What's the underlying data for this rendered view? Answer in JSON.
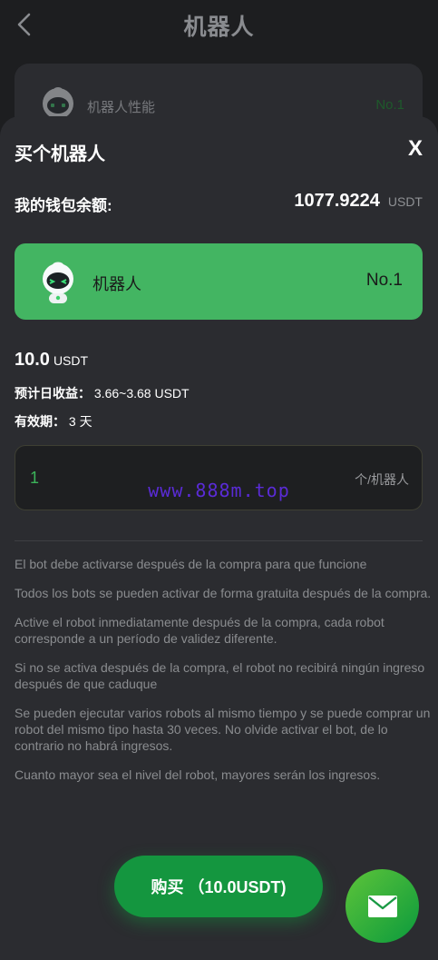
{
  "header": {
    "title": "机器人"
  },
  "background_card": {
    "label": "机器人性能",
    "rank": "No.1"
  },
  "sheet": {
    "title": "买个机器人",
    "close_label": "X",
    "wallet": {
      "label": "我的钱包余额:",
      "amount": "1077.9224",
      "unit": "USDT"
    },
    "robot": {
      "name": "机器人",
      "rank": "No.1"
    },
    "price": {
      "value": "10.0",
      "unit": "USDT"
    },
    "daily_income": {
      "label": "预计日收益：",
      "value": "3.66~3.68 USDT"
    },
    "validity": {
      "label": "有效期：",
      "value": "3 天"
    },
    "quantity": {
      "value": "1",
      "unit": "个/机器人"
    },
    "watermark": "www.888m.top",
    "notes": [
      "El bot debe activarse después de la compra para que funcione",
      "Todos los bots se pueden activar de forma gratuita después de la compra.",
      "Active el robot inmediatamente después de la compra, cada robot corresponde a un período de validez diferente.",
      "Si no se activa después de la compra, el robot no recibirá ningún ingreso después de que caduque",
      "Se pueden ejecutar varios robots al mismo tiempo y se puede comprar un robot del mismo tipo hasta 30 veces. No olvide activar el bot, de lo contrario no habrá ingresos.",
      "Cuanto mayor sea el nivel del robot, mayores serán los ingresos."
    ],
    "buy_button": "购买 （10.0USDT)"
  },
  "icons": {
    "back": "chevron-left-icon",
    "robot": "robot-avatar-icon",
    "mail": "mail-icon"
  },
  "colors": {
    "accent_green": "#43b562",
    "button_green": "#14963f",
    "quantity_text": "#3cb35a",
    "watermark": "#5a2bd6"
  }
}
